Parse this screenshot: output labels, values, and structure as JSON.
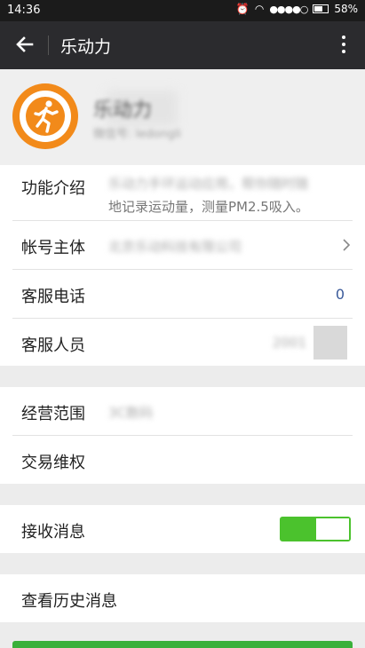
{
  "status": {
    "time": "14:36",
    "signal": "●●●●○",
    "battery": "58%"
  },
  "app_bar": {
    "title": "乐动力"
  },
  "profile": {
    "name": "乐动力",
    "subtitle": "微信号: ledongli"
  },
  "info": {
    "intro_label": "功能介绍",
    "intro_text_line1": "乐动力手环运动应用，帮你随时随",
    "intro_text_line2": "地记录运动量，测量PM2.5吸入。",
    "account_label": "帐号主体",
    "account_value": "北京乐动科技有限公司",
    "phone_label": "客服电话",
    "phone_value": "0",
    "staff_label": "客服人员",
    "staff_value": "2001"
  },
  "business": {
    "scope_label": "经营范围",
    "scope_value": "3C数码",
    "rights_label": "交易维权"
  },
  "messages": {
    "receive_label": "接收消息",
    "receive_enabled": true
  },
  "history": {
    "label": "查看历史消息"
  },
  "colors": {
    "accent": "#4bc22d",
    "logo": "#f28a1a"
  }
}
